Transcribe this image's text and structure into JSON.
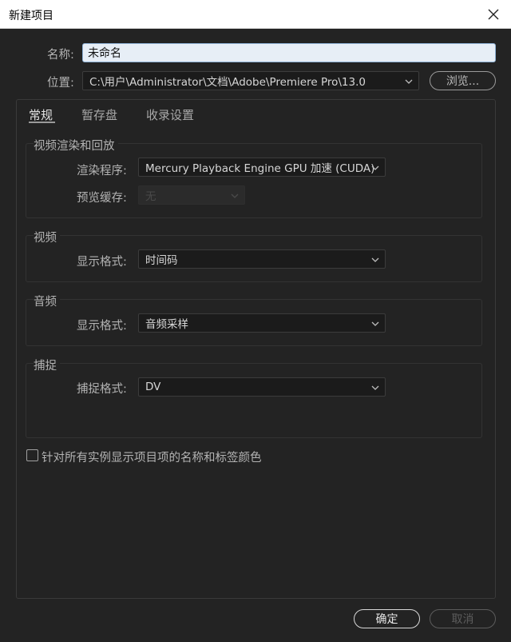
{
  "window": {
    "title": "新建项目"
  },
  "form": {
    "name_label": "名称:",
    "name_value": "未命名",
    "location_label": "位置:",
    "location_value": "C:\\用户\\Administrator\\文档\\Adobe\\Premiere Pro\\13.0",
    "browse_label": "浏览..."
  },
  "tabs": [
    {
      "label": "常规",
      "active": true
    },
    {
      "label": "暂存盘",
      "active": false
    },
    {
      "label": "收录设置",
      "active": false
    }
  ],
  "sections": {
    "render": {
      "title": "视频渲染和回放",
      "renderer_label": "渲染程序:",
      "renderer_value": "Mercury Playback Engine GPU 加速 (CUDA)",
      "preview_cache_label": "预览缓存:",
      "preview_cache_value": "无"
    },
    "video": {
      "title": "视频",
      "display_format_label": "显示格式:",
      "display_format_value": "时间码"
    },
    "audio": {
      "title": "音频",
      "display_format_label": "显示格式:",
      "display_format_value": "音频采样"
    },
    "capture": {
      "title": "捕捉",
      "capture_format_label": "捕捉格式:",
      "capture_format_value": "DV"
    }
  },
  "checkbox": {
    "label": "针对所有实例显示项目项的名称和标签颜色",
    "checked": false
  },
  "footer": {
    "ok_label": "确定",
    "cancel_label": "取消"
  },
  "colors": {
    "background": "#232323",
    "input_focus_border": "#8fb2d6"
  }
}
